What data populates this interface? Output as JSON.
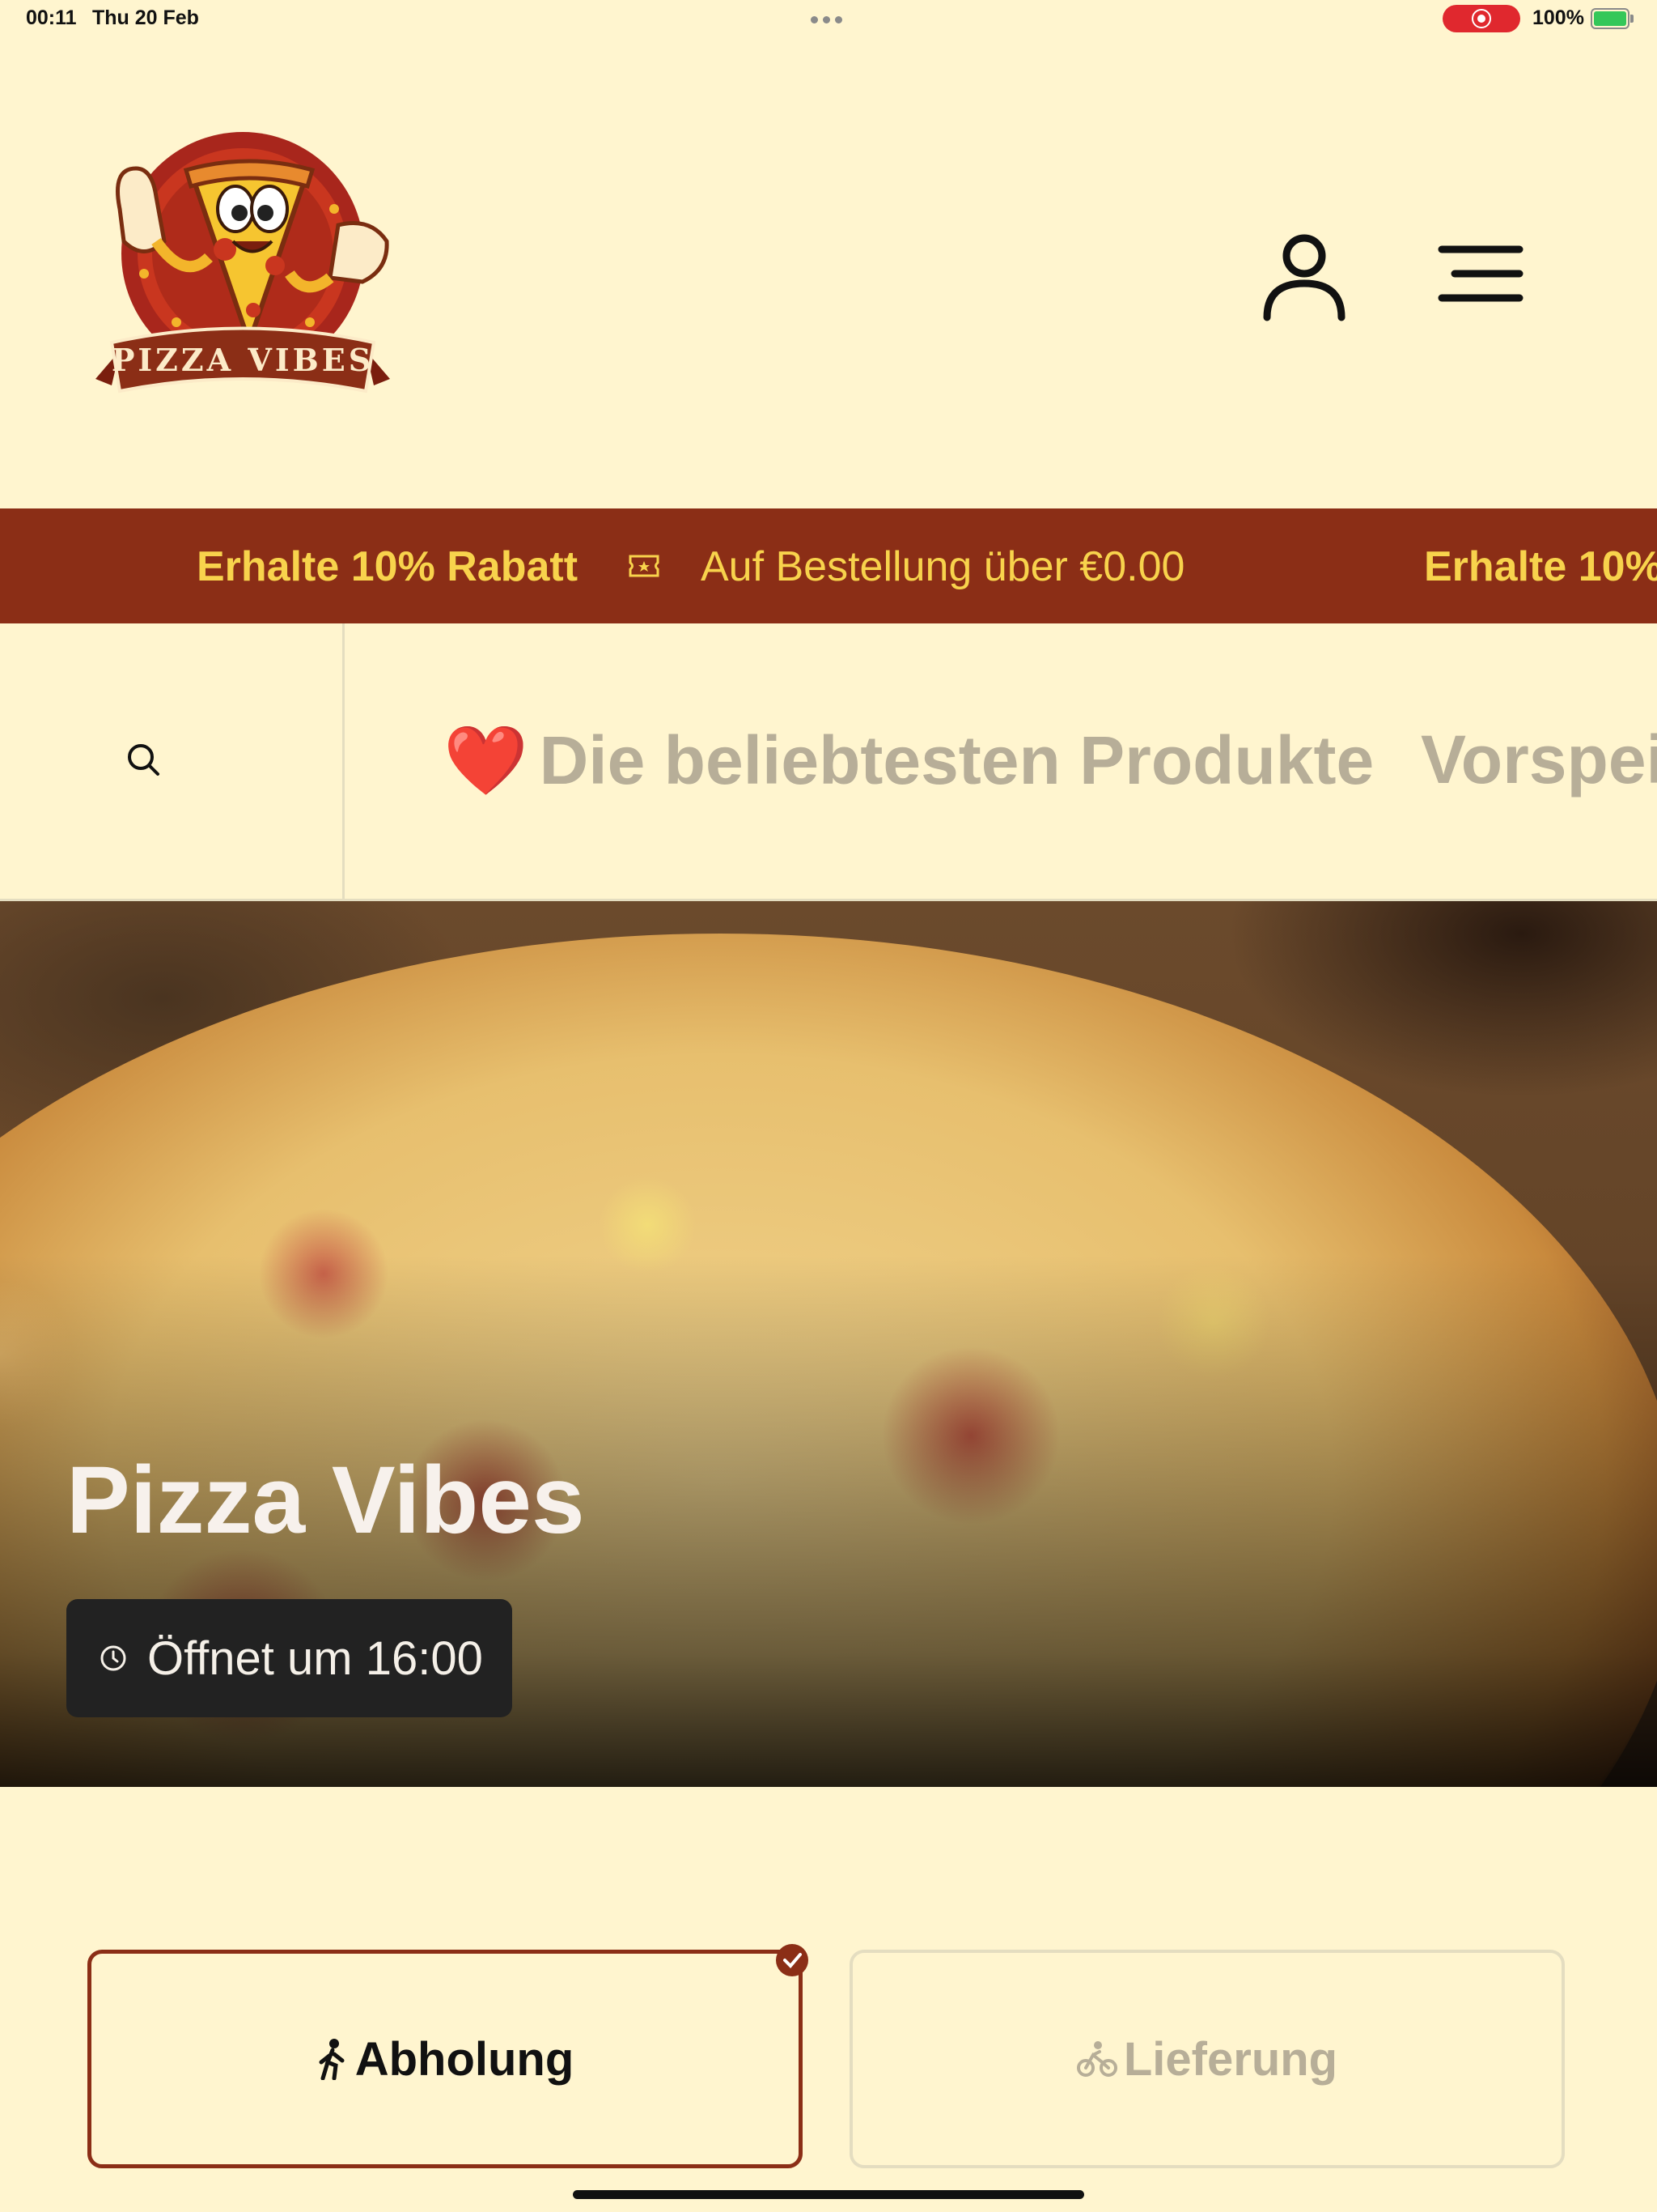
{
  "status_bar": {
    "time": "00:11",
    "date": "Thu 20 Feb",
    "battery": "100%"
  },
  "header": {
    "logo_text": "PIZZA VIBES",
    "icons": [
      "user-icon",
      "menu-icon"
    ]
  },
  "promo": {
    "headline": "Erhalte 10% Rabatt",
    "detail": "Auf Bestellung über €0.00",
    "headline_repeat": "Erhalte 10%",
    "icon": "ticket-icon"
  },
  "categories": {
    "search_icon": "search-icon",
    "items": [
      {
        "emoji": "❤️",
        "label": "Die beliebtesten Produkte"
      },
      {
        "label": "Vorspei"
      }
    ]
  },
  "hero": {
    "title": "Pizza Vibes",
    "opening": "Öffnet um 16:00",
    "icon": "clock-icon"
  },
  "modes": {
    "pickup": {
      "label": "Abholung",
      "selected": true,
      "icon": "walking-icon"
    },
    "delivery": {
      "label": "Lieferung",
      "selected": false,
      "icon": "bicycle-icon"
    }
  },
  "colors": {
    "background": "#FFF5CF",
    "brand": "#8B2E16",
    "promo_text": "#F8D34C",
    "muted": "#B7AE98"
  }
}
